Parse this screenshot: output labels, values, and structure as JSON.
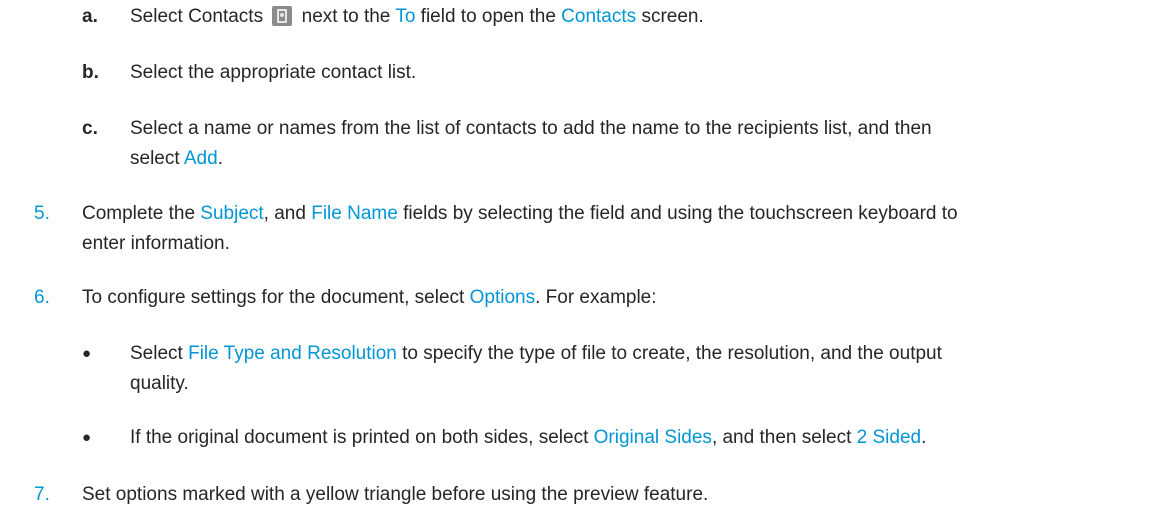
{
  "steps": {
    "a": {
      "marker": "a.",
      "t1": "Select Contacts",
      "t2": "next to the",
      "k1": "To",
      "t3": "field to open the",
      "k2": "Contacts",
      "t4": "screen."
    },
    "b": {
      "marker": "b.",
      "t1": "Select the appropriate contact list."
    },
    "c": {
      "marker": "c.",
      "line1": "Select a name or names from the list of contacts to add the name to the recipients list, and then",
      "t2": "select",
      "k1": "Add",
      "t3": "."
    },
    "s5": {
      "marker": "5.",
      "t1": "Complete the",
      "k1": "Subject",
      "t2": ", and",
      "k2": "File Name",
      "t3": "fields by selecting the field and using the touchscreen keyboard to",
      "line2": "enter information."
    },
    "s6": {
      "marker": "6.",
      "t1": "To configure settings for the document, select",
      "k1": "Options",
      "t2": ". For example:"
    },
    "b1": {
      "marker": "●",
      "t1": "Select",
      "k1": "File Type and Resolution",
      "t2": "to specify the type of file to create, the resolution, and the output",
      "line2": "quality."
    },
    "b2": {
      "marker": "●",
      "t1": "If the original document is printed on both sides, select",
      "k1": "Original Sides",
      "t2": ", and then select",
      "k2": "2 Sided",
      "t3": "."
    },
    "s7": {
      "marker": "7.",
      "t1": "Set options marked with a yellow triangle before using the preview feature."
    }
  },
  "icons": {
    "contacts": "contacts-icon"
  },
  "colors": {
    "link": "#0096d6",
    "text": "#262626"
  }
}
